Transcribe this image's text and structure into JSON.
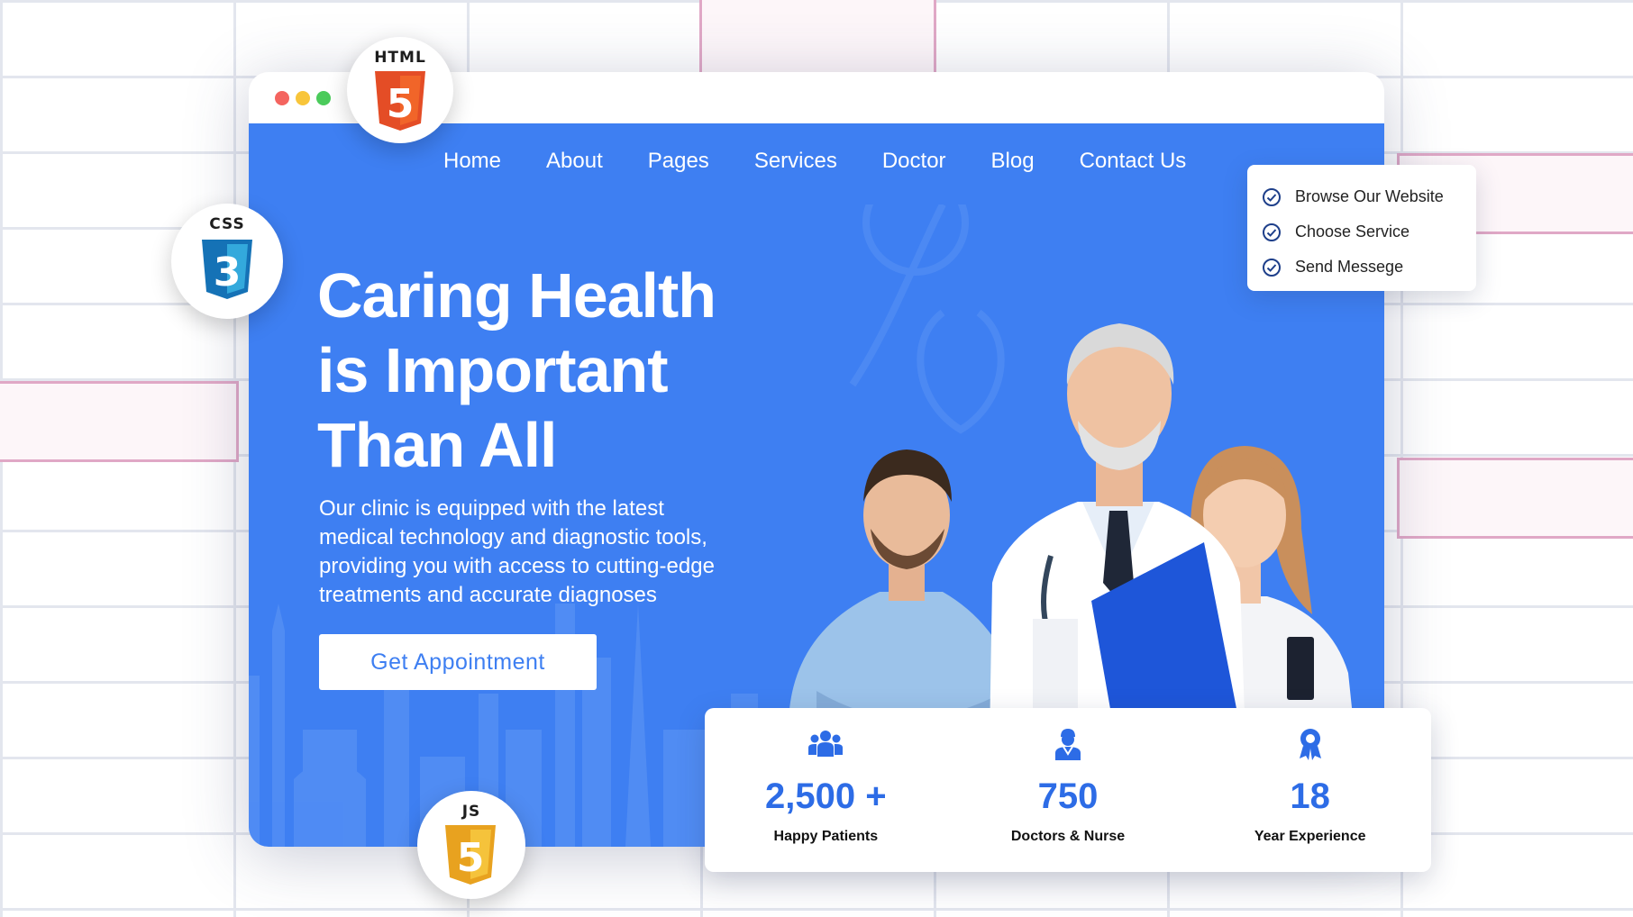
{
  "nav": {
    "items": [
      {
        "label": "Home"
      },
      {
        "label": "About"
      },
      {
        "label": "Pages"
      },
      {
        "label": "Services"
      },
      {
        "label": "Doctor"
      },
      {
        "label": "Blog"
      },
      {
        "label": "Contact Us"
      }
    ]
  },
  "hero": {
    "title_line1": "Caring Health",
    "title_line2": "is Important",
    "title_line3": "Than All",
    "desc_line1": "Our clinic is equipped with the latest",
    "desc_line2": "medical technology and diagnostic tools,",
    "desc_line3": "providing you with access to cutting-edge",
    "desc_line4": "treatments and accurate diagnoses",
    "cta_label": "Get Appointment"
  },
  "checklist": {
    "items": [
      {
        "label": "Browse Our Website",
        "icon": "check-circle-icon"
      },
      {
        "label": "Choose Service",
        "icon": "check-circle-icon"
      },
      {
        "label": "Send Messege",
        "icon": "check-circle-icon"
      }
    ]
  },
  "stats": [
    {
      "value": "2,500 +",
      "label": "Happy Patients",
      "icon": "patients-group-icon"
    },
    {
      "value": "750",
      "label": "Doctors & Nurse",
      "icon": "doctor-icon"
    },
    {
      "value": "18",
      "label": "Year Experience",
      "icon": "award-icon"
    }
  ],
  "logos": {
    "html": {
      "text": "HTML",
      "digit": "5",
      "color": "#e44d26"
    },
    "css": {
      "text": "CSS",
      "digit": "3",
      "color": "#2965f1"
    },
    "js": {
      "text": "JS",
      "digit": "5",
      "color": "#f0b429"
    }
  },
  "colors": {
    "hero_bg": "#3e7ff2",
    "accent": "#2d6ce6",
    "dot_red": "#f4645f",
    "dot_yellow": "#f8c53a",
    "dot_green": "#4bcb5b"
  }
}
